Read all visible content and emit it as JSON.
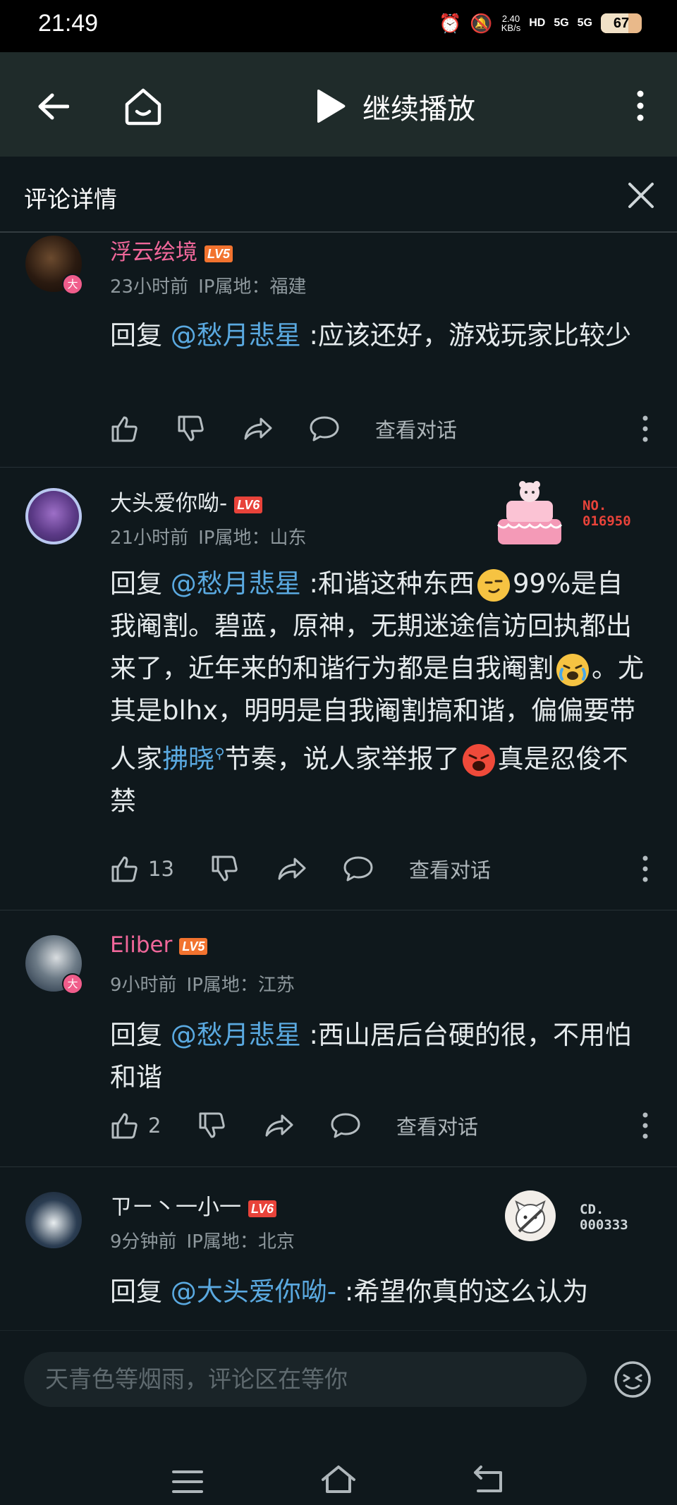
{
  "status_bar": {
    "time": "21:49",
    "net_speed_value": "2.40",
    "net_speed_unit": "KB/s",
    "hd": "HD",
    "sig1": "5G",
    "sig2": "5G",
    "battery": "67"
  },
  "header": {
    "play_label": "继续播放"
  },
  "sheet": {
    "title": "评论详情"
  },
  "comments": [
    {
      "user": "浮云绘境",
      "level": "LV5",
      "time": "23小时前",
      "ip": "IP属地：福建",
      "reply_prefix": "回复 ",
      "mention": "@愁月悲星",
      "text": " :应该还好，游戏玩家比较少",
      "likes": "",
      "view_label": "查看对话"
    },
    {
      "user": "大头爱你呦-",
      "level": "LV6",
      "time": "21小时前",
      "ip": "IP属地：山东",
      "reply_prefix": "回复 ",
      "mention": "@愁月悲星",
      "text_a": " :和谐这种东西",
      "text_b": "99%是自我阉割。碧蓝，原神，无期迷途信访回执都出来了，近年来的和谐行为都是自我阉割",
      "text_c": "。尤其是blhx，明明是自我阉割搞和谐，偏偏要带人家",
      "link": "拂晓",
      "text_d": "节奏，说人家举报了",
      "text_e": "真是忍俊不禁",
      "likes": "13",
      "view_label": "查看对话",
      "fan_no_label": "NO.",
      "fan_no": "016950"
    },
    {
      "user": "Eliber",
      "level": "LV5",
      "time": "9小时前",
      "ip": "IP属地：江苏",
      "reply_prefix": "回复 ",
      "mention": "@愁月悲星",
      "text": " :西山居后台硬的很，不用怕和谐",
      "likes": "2",
      "view_label": "查看对话"
    },
    {
      "user": "ㄗㄧ丶一小一",
      "level": "LV6",
      "time": "9分钟前",
      "ip": "IP属地：北京",
      "reply_prefix": "回复 ",
      "mention": "@大头爱你呦-",
      "text": " :希望你真的这么认为",
      "fan_no_label": "CD.",
      "fan_no": "000333"
    }
  ],
  "composer": {
    "placeholder": "天青色等烟雨，评论区在等你"
  },
  "icons": {
    "back": "back-arrow-icon",
    "home": "home-icon",
    "play": "play-icon",
    "more": "more-vertical-icon",
    "close": "close-icon",
    "like": "thumb-up-icon",
    "dislike": "thumb-down-icon",
    "share": "share-icon",
    "reply": "comment-bubble-icon",
    "emoji": "emoji-icon",
    "nav_menu": "menu-icon",
    "nav_home": "nav-home-icon",
    "nav_back": "nav-back-icon"
  },
  "colors": {
    "background": "#0f181c",
    "header": "#1f2b2a",
    "username_pink": "#f0679a",
    "mention_blue": "#5aa9e0",
    "lv5": "#f2732f",
    "lv6": "#e8433a",
    "meta_gray": "#8e989d"
  }
}
